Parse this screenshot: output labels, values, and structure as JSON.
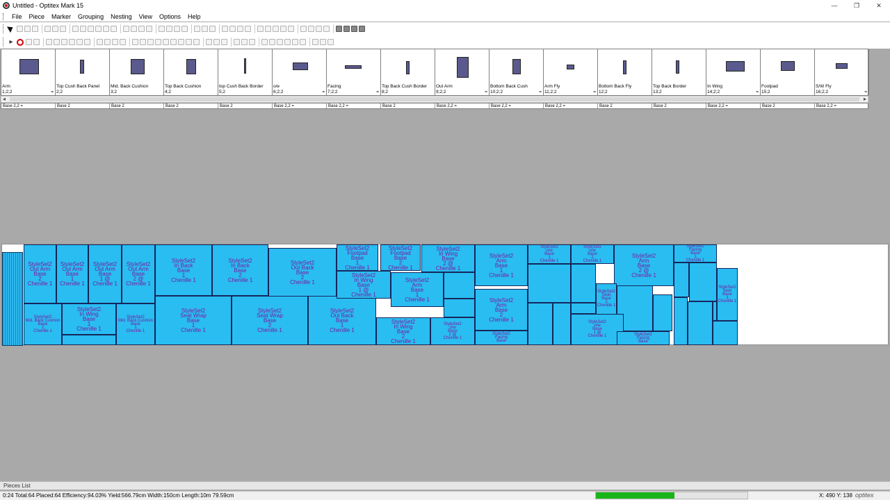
{
  "window": {
    "title": "Untitled - Optitex Mark 15",
    "minimize": "—",
    "maximize": "❐",
    "close": "✕"
  },
  "menu": [
    "File",
    "Piece",
    "Marker",
    "Grouping",
    "Nesting",
    "View",
    "Options",
    "Help"
  ],
  "pieces": [
    {
      "name": "Arm",
      "count": "1;2;2",
      "eq": "="
    },
    {
      "name": "Top Cush Back Panel",
      "count": "2;2",
      "eq": ""
    },
    {
      "name": "Mid. Back Cushion",
      "count": "3;2",
      "eq": ""
    },
    {
      "name": "Top Back Cushion",
      "count": "4;2",
      "eq": ""
    },
    {
      "name": "top Cush Back Border",
      "count": "5;2",
      "eq": ""
    },
    {
      "name": "o/e",
      "count": "6;2;2",
      "eq": "="
    },
    {
      "name": "Facing",
      "count": "7;2;2",
      "eq": "="
    },
    {
      "name": "Top Back Cush Border",
      "count": "8;2",
      "eq": ""
    },
    {
      "name": "Out Arm",
      "count": "9;2;2",
      "eq": "="
    },
    {
      "name": "Bottom Back Cush",
      "count": "10;2;2",
      "eq": "="
    },
    {
      "name": "Arm Fly",
      "count": "11;2;2",
      "eq": "="
    },
    {
      "name": "Bottom Back Fly",
      "count": "12;2",
      "eq": ""
    },
    {
      "name": "Top Back Border",
      "count": "13;2",
      "eq": ""
    },
    {
      "name": "In Wing",
      "count": "14;2;2",
      "eq": "="
    },
    {
      "name": "Footpad",
      "count": "15;2",
      "eq": ""
    },
    {
      "name": "S/W Fly",
      "count": "16;2;2",
      "eq": "="
    }
  ],
  "piece_lines": [
    "Base 2,2 =",
    "Base 2",
    "Base 2",
    "Base 2",
    "Base 2",
    "Base 2,2 =",
    "Base 2,2 =",
    "Base 2",
    "Base 2,2 =",
    "Base 2,2 =",
    "Base 2,2 =",
    "Base 2",
    "Base 2",
    "Base 2,2 =",
    "Base 2",
    "Base 2,2 ="
  ],
  "marker_pieces": [
    {
      "t": [
        "StyleSet2",
        "Out Arm",
        "Base",
        "2",
        "Chenille 1"
      ]
    },
    {
      "t": [
        "StyleSet2",
        "Out Arm",
        "Base",
        "1",
        "Chenille 1"
      ]
    },
    {
      "t": [
        "StyleSet2",
        "Out Arm",
        "Base",
        "1 @",
        "Chenille 1"
      ]
    },
    {
      "t": [
        "StyleSet2",
        "Out Arm",
        "Base",
        "2 @",
        "Chenille 1"
      ]
    },
    {
      "t": [
        "StyleSet2",
        "In Back",
        "Base",
        "1",
        "Chenille 1"
      ]
    },
    {
      "t": [
        "StyleSet2",
        "In Back",
        "Base",
        "2",
        "Chenille 1"
      ]
    },
    {
      "t": [
        "StyleSet2",
        "Out Back",
        "Base",
        "2",
        "Chenille 1"
      ]
    },
    {
      "t": [
        "StyleSet2",
        "Mid. Back Cushion",
        "Base",
        "2",
        "Chenille 1"
      ]
    },
    {
      "t": [
        "StyleSet2",
        "In Wing",
        "Base",
        "1",
        "Chenille 1"
      ]
    },
    {
      "t": [
        "StyleSet2",
        "Mid. Back Cushion",
        "Base",
        "1",
        "Chenille 1"
      ]
    },
    {
      "t": [
        "StyleSet2",
        "Seat Wrap",
        "Base",
        "1",
        "Chenille 1"
      ]
    },
    {
      "t": [
        "StyleSet2",
        "Seat Wrap",
        "Base",
        "2",
        "Chenille 1"
      ]
    },
    {
      "t": [
        "StyleSet2",
        "Out Back",
        "Base",
        "1",
        "Chenille 1"
      ]
    },
    {
      "t": [
        "StyleSet2",
        "Footpad",
        "Base",
        "1",
        "Chenille 1"
      ]
    },
    {
      "t": [
        "StyleSet2",
        "Footpad",
        "Base",
        "2",
        "Chenille 1"
      ]
    },
    {
      "t": [
        "StyleSet2",
        "In Wing",
        "Base",
        "2 @",
        "Chenille 1"
      ]
    },
    {
      "t": [
        "StyleSet2",
        "In Wing",
        "Base",
        "1 @",
        "Chenille 1"
      ]
    },
    {
      "t": [
        "StyleSet2",
        "Arm",
        "Base",
        "1",
        "Chenille 1"
      ]
    },
    {
      "t": [
        "StyleSet2",
        "Arm",
        "Base",
        "1",
        "Chenille 1"
      ]
    },
    {
      "t": [
        "StyleSet2",
        "Arm",
        "Base",
        "2",
        "Chenille 1"
      ]
    },
    {
      "t": [
        "StyleSet2",
        "In Wing",
        "Base",
        "2",
        "Chenille 1"
      ]
    },
    {
      "t": [
        "StyleSet2",
        "o/w",
        "Base",
        "2 @",
        "Chenille 1"
      ]
    },
    {
      "t": [
        "StyleSet2",
        "Facing",
        "Base"
      ]
    },
    {
      "t": [
        "StyleSet2",
        "o/w",
        "Base",
        "1",
        "Chenille 1"
      ]
    },
    {
      "t": [
        "StyleSet2",
        "o/w",
        "Base",
        "2",
        "Chenille 1"
      ]
    },
    {
      "t": [
        "StyleSet2",
        "Arm",
        "Base",
        "2 @",
        "Chenille 1"
      ]
    },
    {
      "t": [
        "StyleSet2",
        "Seat",
        "Base",
        "2",
        "Chenille 1"
      ]
    },
    {
      "t": [
        "StyleSet2",
        "o/w",
        "Base",
        "1 @",
        "Chenille 1"
      ]
    },
    {
      "t": [
        "StyleSet2",
        "Facing",
        "Base",
        "1",
        "Chenille 1"
      ]
    },
    {
      "t": [
        "StyleSet2",
        "Facing",
        "Base"
      ]
    },
    {
      "t": [
        "StyleSet2",
        "Seat",
        "Base",
        "1",
        "Chenille 1"
      ]
    }
  ],
  "pieces_list_label": "Pieces List",
  "status": {
    "text": "0:24  Total:64  Placed:64  Efficiency:94.03%  Yield:566.79cm  Width:150cm  Length:10m 79.59cm",
    "progress": 0.52,
    "coords": "X: 490  Y: 138",
    "logo": "optitex"
  }
}
